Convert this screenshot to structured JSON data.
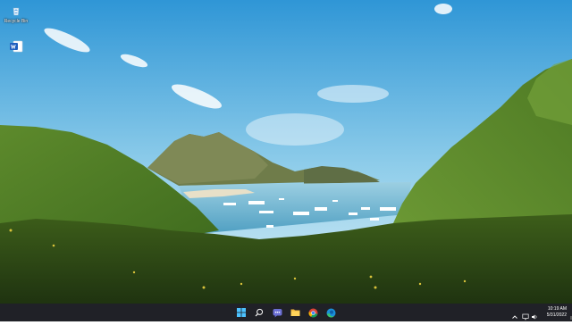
{
  "desktop": {
    "icons": [
      {
        "name": "recycle-bin",
        "label": "Recycle Bin"
      },
      {
        "name": "word-document",
        "label": ""
      }
    ]
  },
  "taskbar": {
    "apps": [
      {
        "name": "start",
        "icon": "windows-logo-icon"
      },
      {
        "name": "search",
        "icon": "search-icon"
      },
      {
        "name": "chat",
        "icon": "chat-icon"
      },
      {
        "name": "file-explorer",
        "icon": "folder-icon"
      },
      {
        "name": "chrome",
        "icon": "chrome-icon"
      },
      {
        "name": "edge",
        "icon": "edge-icon"
      }
    ],
    "tray": {
      "time": "10:19 AM",
      "date": "5/31/2022"
    }
  },
  "colors": {
    "taskbar": "#202127",
    "accent": "#4cc2ff",
    "sky": "#7fc3e6",
    "sea": "#5aaed0"
  }
}
